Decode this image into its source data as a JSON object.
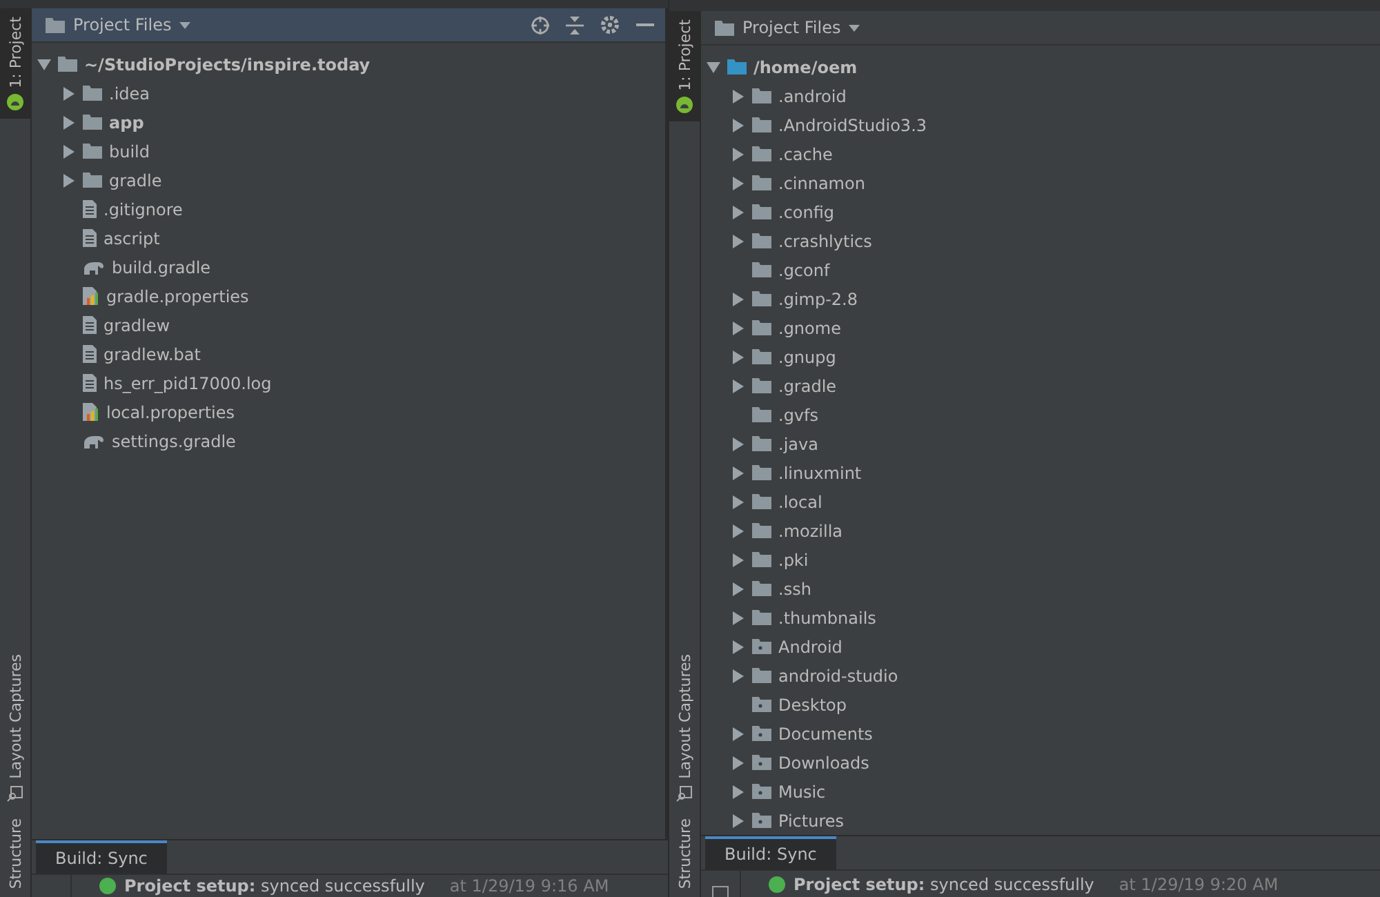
{
  "windows": [
    {
      "side_tabs": [
        {
          "label": "1: Project",
          "selected": true,
          "kind": "project"
        },
        {
          "label": "Layout Captures",
          "selected": false,
          "kind": "captures"
        },
        {
          "label": "Structure",
          "selected": false,
          "kind": "structure"
        }
      ],
      "panel": {
        "title": "Project Files",
        "tools": true
      },
      "tree": {
        "label": "~/StudioProjects/inspire.today",
        "kind": "root",
        "expanded": true,
        "children": [
          {
            "label": ".idea",
            "kind": "folder",
            "expandable": true
          },
          {
            "label": "app",
            "kind": "module",
            "expandable": true
          },
          {
            "label": "build",
            "kind": "folder",
            "expandable": true
          },
          {
            "label": "gradle",
            "kind": "folder",
            "expandable": true
          },
          {
            "label": ".gitignore",
            "kind": "text",
            "expandable": false
          },
          {
            "label": "ascript",
            "kind": "text",
            "expandable": false
          },
          {
            "label": "build.gradle",
            "kind": "gradle",
            "expandable": false
          },
          {
            "label": "gradle.properties",
            "kind": "properties",
            "expandable": false
          },
          {
            "label": "gradlew",
            "kind": "text",
            "expandable": false
          },
          {
            "label": "gradlew.bat",
            "kind": "text",
            "expandable": false
          },
          {
            "label": "hs_err_pid17000.log",
            "kind": "text",
            "expandable": false
          },
          {
            "label": "local.properties",
            "kind": "properties",
            "expandable": false
          },
          {
            "label": "settings.gradle",
            "kind": "gradle",
            "expandable": false
          }
        ]
      },
      "build_tab": {
        "label": "Build: Sync",
        "selected": true
      },
      "status": {
        "message": "**Project setup:** synced successfully",
        "time": "at 1/29/19 9:16 AM"
      }
    },
    {
      "side_tabs": [
        {
          "label": "1: Project",
          "selected": true,
          "kind": "project"
        },
        {
          "label": "Layout Captures",
          "selected": false,
          "kind": "captures"
        },
        {
          "label": "Structure",
          "selected": false,
          "kind": "structure"
        }
      ],
      "panel": {
        "title": "Project Files",
        "tools": false
      },
      "tree": {
        "label": "/home/oem",
        "kind": "home",
        "expanded": true,
        "children": [
          {
            "label": ".android",
            "kind": "folder",
            "expandable": true
          },
          {
            "label": ".AndroidStudio3.3",
            "kind": "folder",
            "expandable": true
          },
          {
            "label": ".cache",
            "kind": "folder",
            "expandable": true
          },
          {
            "label": ".cinnamon",
            "kind": "folder",
            "expandable": true
          },
          {
            "label": ".config",
            "kind": "folder",
            "expandable": true
          },
          {
            "label": ".crashlytics",
            "kind": "folder",
            "expandable": true
          },
          {
            "label": ".gconf",
            "kind": "folder",
            "expandable": false
          },
          {
            "label": ".gimp-2.8",
            "kind": "folder",
            "expandable": true
          },
          {
            "label": ".gnome",
            "kind": "folder",
            "expandable": true
          },
          {
            "label": ".gnupg",
            "kind": "folder",
            "expandable": true
          },
          {
            "label": ".gradle",
            "kind": "folder",
            "expandable": true
          },
          {
            "label": ".gvfs",
            "kind": "folder",
            "expandable": false
          },
          {
            "label": ".java",
            "kind": "folder",
            "expandable": true
          },
          {
            "label": ".linuxmint",
            "kind": "folder",
            "expandable": true
          },
          {
            "label": ".local",
            "kind": "folder",
            "expandable": true
          },
          {
            "label": ".mozilla",
            "kind": "folder",
            "expandable": true
          },
          {
            "label": ".pki",
            "kind": "folder",
            "expandable": true
          },
          {
            "label": ".ssh",
            "kind": "folder",
            "expandable": true
          },
          {
            "label": ".thumbnails",
            "kind": "folder",
            "expandable": true
          },
          {
            "label": "Android",
            "kind": "special",
            "expandable": true
          },
          {
            "label": "android-studio",
            "kind": "folder",
            "expandable": true
          },
          {
            "label": "Desktop",
            "kind": "special",
            "expandable": false
          },
          {
            "label": "Documents",
            "kind": "special",
            "expandable": true
          },
          {
            "label": "Downloads",
            "kind": "special",
            "expandable": true
          },
          {
            "label": "Music",
            "kind": "special",
            "expandable": true
          },
          {
            "label": "Pictures",
            "kind": "special",
            "expandable": true
          }
        ]
      },
      "build_tab": {
        "label": "Build: Sync",
        "selected": true
      },
      "status": {
        "message": "**Project setup:** synced successfully",
        "time": "at 1/29/19 9:20 AM"
      }
    }
  ]
}
